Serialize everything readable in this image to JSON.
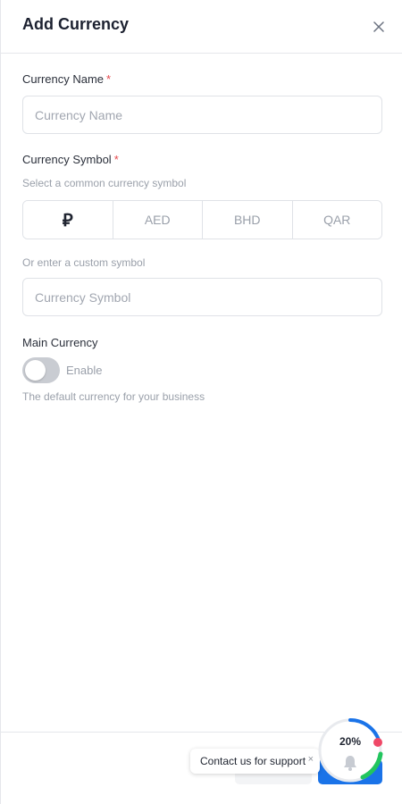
{
  "modal": {
    "title": "Add Currency",
    "close_icon": "close-icon"
  },
  "currency_name": {
    "label": "Currency Name",
    "required_mark": "*",
    "placeholder": "Currency Name",
    "value": ""
  },
  "currency_symbol": {
    "label": "Currency Symbol",
    "required_mark": "*",
    "common_hint": "Select a common currency symbol",
    "options": [
      {
        "label": "⃁",
        "icon": "saudi-riyal-symbol",
        "selected": true
      },
      {
        "label": "AED",
        "selected": false
      },
      {
        "label": "BHD",
        "selected": false
      },
      {
        "label": "QAR",
        "selected": false
      }
    ],
    "custom_hint": "Or enter a custom symbol",
    "placeholder": "Currency Symbol",
    "value": ""
  },
  "main_currency": {
    "label": "Main Currency",
    "toggle_label": "Enable",
    "enabled": false,
    "description": "The default currency for your business"
  },
  "support_chip": {
    "label": "Contact us for support",
    "close_label": "×"
  },
  "progress_widget": {
    "percent_label": "20%",
    "progress": 0.2,
    "icon": "bell-icon",
    "colors": {
      "ring": "#1a73e8",
      "ring_accent": "#22c55e",
      "dot": "#ef4867"
    }
  },
  "colors": {
    "required": "#e5484d",
    "primary": "#1a73e8",
    "hint_text": "#9aa0aa",
    "border": "#dfe2e7"
  }
}
